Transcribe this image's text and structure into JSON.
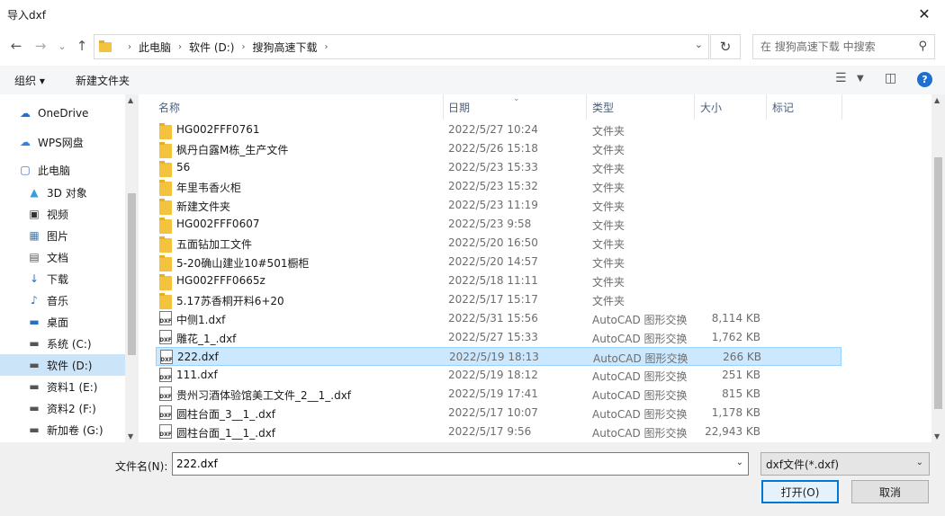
{
  "window": {
    "title": "导入dxf",
    "close": "✕"
  },
  "nav": {
    "back": "←",
    "forward": "→",
    "history": "⌄",
    "up": "↑",
    "breadcrumbs": [
      "此电脑",
      "软件 (D:)",
      "搜狗高速下载"
    ],
    "refresh": "↻",
    "search_placeholder": "在 搜狗高速下载 中搜索"
  },
  "toolbar": {
    "organize": "组织 ▾",
    "new_folder": "新建文件夹"
  },
  "sidebar": {
    "items": [
      {
        "label": "OneDrive",
        "icon": "cloud-icon"
      },
      {
        "label": "WPS网盘",
        "icon": "cloud-icon"
      },
      {
        "label": "此电脑",
        "icon": "computer-icon"
      },
      {
        "label": "3D 对象",
        "icon": "cube-icon"
      },
      {
        "label": "视频",
        "icon": "video-icon"
      },
      {
        "label": "图片",
        "icon": "image-icon"
      },
      {
        "label": "文档",
        "icon": "document-icon"
      },
      {
        "label": "下载",
        "icon": "download-icon"
      },
      {
        "label": "音乐",
        "icon": "music-icon"
      },
      {
        "label": "桌面",
        "icon": "desktop-icon"
      },
      {
        "label": "系统 (C:)",
        "icon": "drive-icon"
      },
      {
        "label": "软件 (D:)",
        "icon": "drive-icon",
        "selected": true
      },
      {
        "label": "资料1 (E:)",
        "icon": "drive-icon"
      },
      {
        "label": "资料2 (F:)",
        "icon": "drive-icon"
      },
      {
        "label": "新加卷 (G:)",
        "icon": "drive-icon"
      }
    ]
  },
  "columns": {
    "name": "名称",
    "date": "日期",
    "type": "类型",
    "size": "大小",
    "tag": "标记"
  },
  "files": [
    {
      "name": "HG002FFF0761",
      "date": "2022/5/27 10:24",
      "type": "文件夹",
      "size": "",
      "kind": "folder"
    },
    {
      "name": "枫丹白露M栋_生产文件",
      "date": "2022/5/26 15:18",
      "type": "文件夹",
      "size": "",
      "kind": "folder"
    },
    {
      "name": "56",
      "date": "2022/5/23 15:33",
      "type": "文件夹",
      "size": "",
      "kind": "folder"
    },
    {
      "name": "年里韦香火柜",
      "date": "2022/5/23 15:32",
      "type": "文件夹",
      "size": "",
      "kind": "folder"
    },
    {
      "name": "新建文件夹",
      "date": "2022/5/23 11:19",
      "type": "文件夹",
      "size": "",
      "kind": "folder"
    },
    {
      "name": "HG002FFF0607",
      "date": "2022/5/23 9:58",
      "type": "文件夹",
      "size": "",
      "kind": "folder"
    },
    {
      "name": "五面钻加工文件",
      "date": "2022/5/20 16:50",
      "type": "文件夹",
      "size": "",
      "kind": "folder"
    },
    {
      "name": "5-20确山建业10#501橱柜",
      "date": "2022/5/20 14:57",
      "type": "文件夹",
      "size": "",
      "kind": "folder"
    },
    {
      "name": "HG002FFF0665z",
      "date": "2022/5/18 11:11",
      "type": "文件夹",
      "size": "",
      "kind": "folder"
    },
    {
      "name": "5.17苏香桐开料6+20",
      "date": "2022/5/17 15:17",
      "type": "文件夹",
      "size": "",
      "kind": "folder"
    },
    {
      "name": "中侧1.dxf",
      "date": "2022/5/31 15:56",
      "type": "AutoCAD 图形交换",
      "size": "8,114 KB",
      "kind": "dxf"
    },
    {
      "name": "雕花_1_.dxf",
      "date": "2022/5/27 15:33",
      "type": "AutoCAD 图形交换",
      "size": "1,762 KB",
      "kind": "dxf"
    },
    {
      "name": "222.dxf",
      "date": "2022/5/19 18:13",
      "type": "AutoCAD 图形交换",
      "size": "266 KB",
      "kind": "dxf",
      "selected": true
    },
    {
      "name": "111.dxf",
      "date": "2022/5/19 18:12",
      "type": "AutoCAD 图形交换",
      "size": "251 KB",
      "kind": "dxf"
    },
    {
      "name": "贵州习酒体验馆美工文件_2__1_.dxf",
      "date": "2022/5/19 17:41",
      "type": "AutoCAD 图形交换",
      "size": "815 KB",
      "kind": "dxf"
    },
    {
      "name": "圆柱台面_3__1_.dxf",
      "date": "2022/5/17 10:07",
      "type": "AutoCAD 图形交换",
      "size": "1,178 KB",
      "kind": "dxf"
    },
    {
      "name": "圆柱台面_1__1_.dxf",
      "date": "2022/5/17 9:56",
      "type": "AutoCAD 图形交换",
      "size": "22,943 KB",
      "kind": "dxf"
    }
  ],
  "bottom": {
    "filename_label": "文件名(N):",
    "filename_value": "222.dxf",
    "filetype_value": "dxf文件(*.dxf)",
    "open_label": "打开(O)",
    "cancel_label": "取消"
  },
  "dxf_icon_text": "DXF"
}
